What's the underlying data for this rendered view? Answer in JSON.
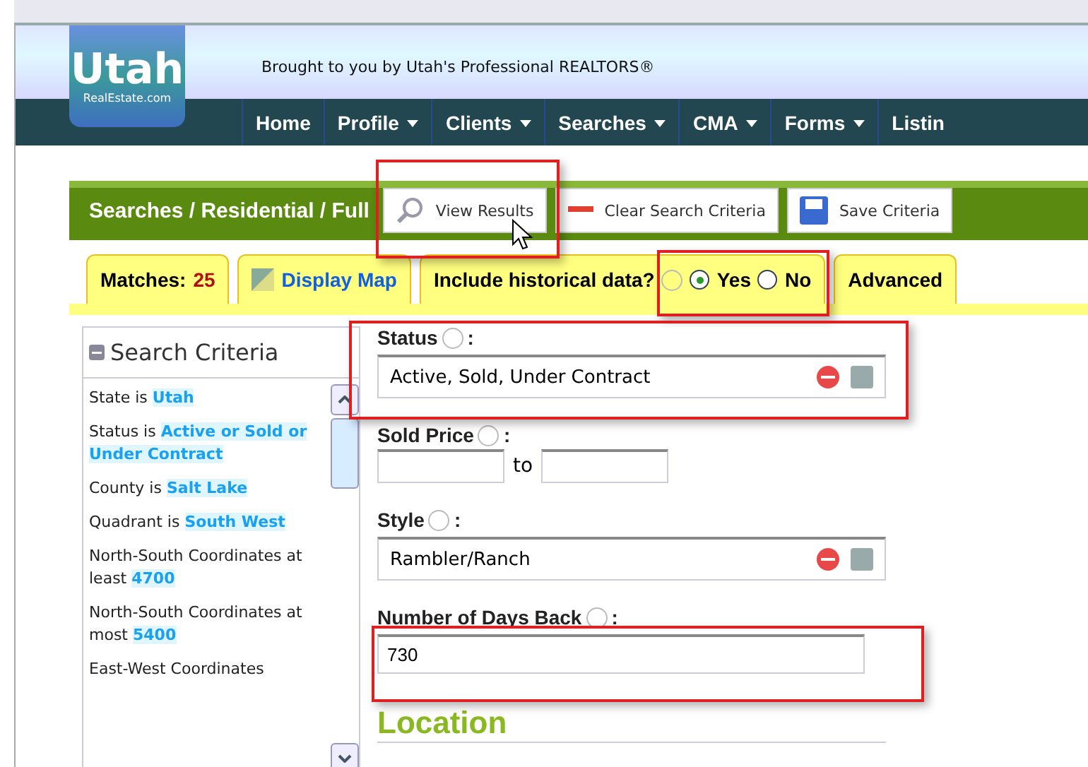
{
  "logo": {
    "title": "Utah",
    "subtitle": "RealEstate.com"
  },
  "tagline": "Brought to you by Utah's Professional REALTORS®",
  "nav": [
    {
      "label": "Home",
      "dropdown": false
    },
    {
      "label": "Profile",
      "dropdown": true
    },
    {
      "label": "Clients",
      "dropdown": true
    },
    {
      "label": "Searches",
      "dropdown": true
    },
    {
      "label": "CMA",
      "dropdown": true
    },
    {
      "label": "Forms",
      "dropdown": true
    },
    {
      "label": "Listin",
      "dropdown": false
    }
  ],
  "breadcrumb": "Searches / Residential / Full",
  "toolbar": [
    {
      "kind": "search",
      "label": "View Results"
    },
    {
      "kind": "clear",
      "label": "Clear Search Criteria"
    },
    {
      "kind": "save",
      "label": "Save Criteria"
    }
  ],
  "tabs": [
    {
      "kind": "matches",
      "label": "Matches:",
      "count": "25"
    },
    {
      "kind": "map",
      "label": "Display Map"
    },
    {
      "kind": "historical",
      "label": "Include historical data?",
      "options": [
        {
          "label": "Yes",
          "selected": true
        },
        {
          "label": "No",
          "selected": false
        }
      ]
    },
    {
      "kind": "plain",
      "label": "Advanced"
    }
  ],
  "criteria": {
    "title": "Search Criteria",
    "items": [
      "State is **Utah**",
      "Status is **Active or Sold or Under Contract**",
      "County is **Salt Lake**",
      "Quadrant is **South West**",
      "North-South Coordinates at least **4700**",
      "North-South Coordinates at most **5400**",
      "East-West Coordinates"
    ]
  },
  "fields": [
    {
      "kind": "select",
      "label": "Status",
      "colon": ":",
      "value": "Active, Sold, Under Contract"
    },
    {
      "kind": "range",
      "label": "Sold Price",
      "colon": ":",
      "between": "to"
    },
    {
      "kind": "select",
      "label": "Style",
      "colon": ":",
      "value": "Rambler/Ranch"
    },
    {
      "kind": "text",
      "label": "Number of Days Back",
      "colon": ":",
      "value": "730"
    }
  ],
  "section": "Location"
}
